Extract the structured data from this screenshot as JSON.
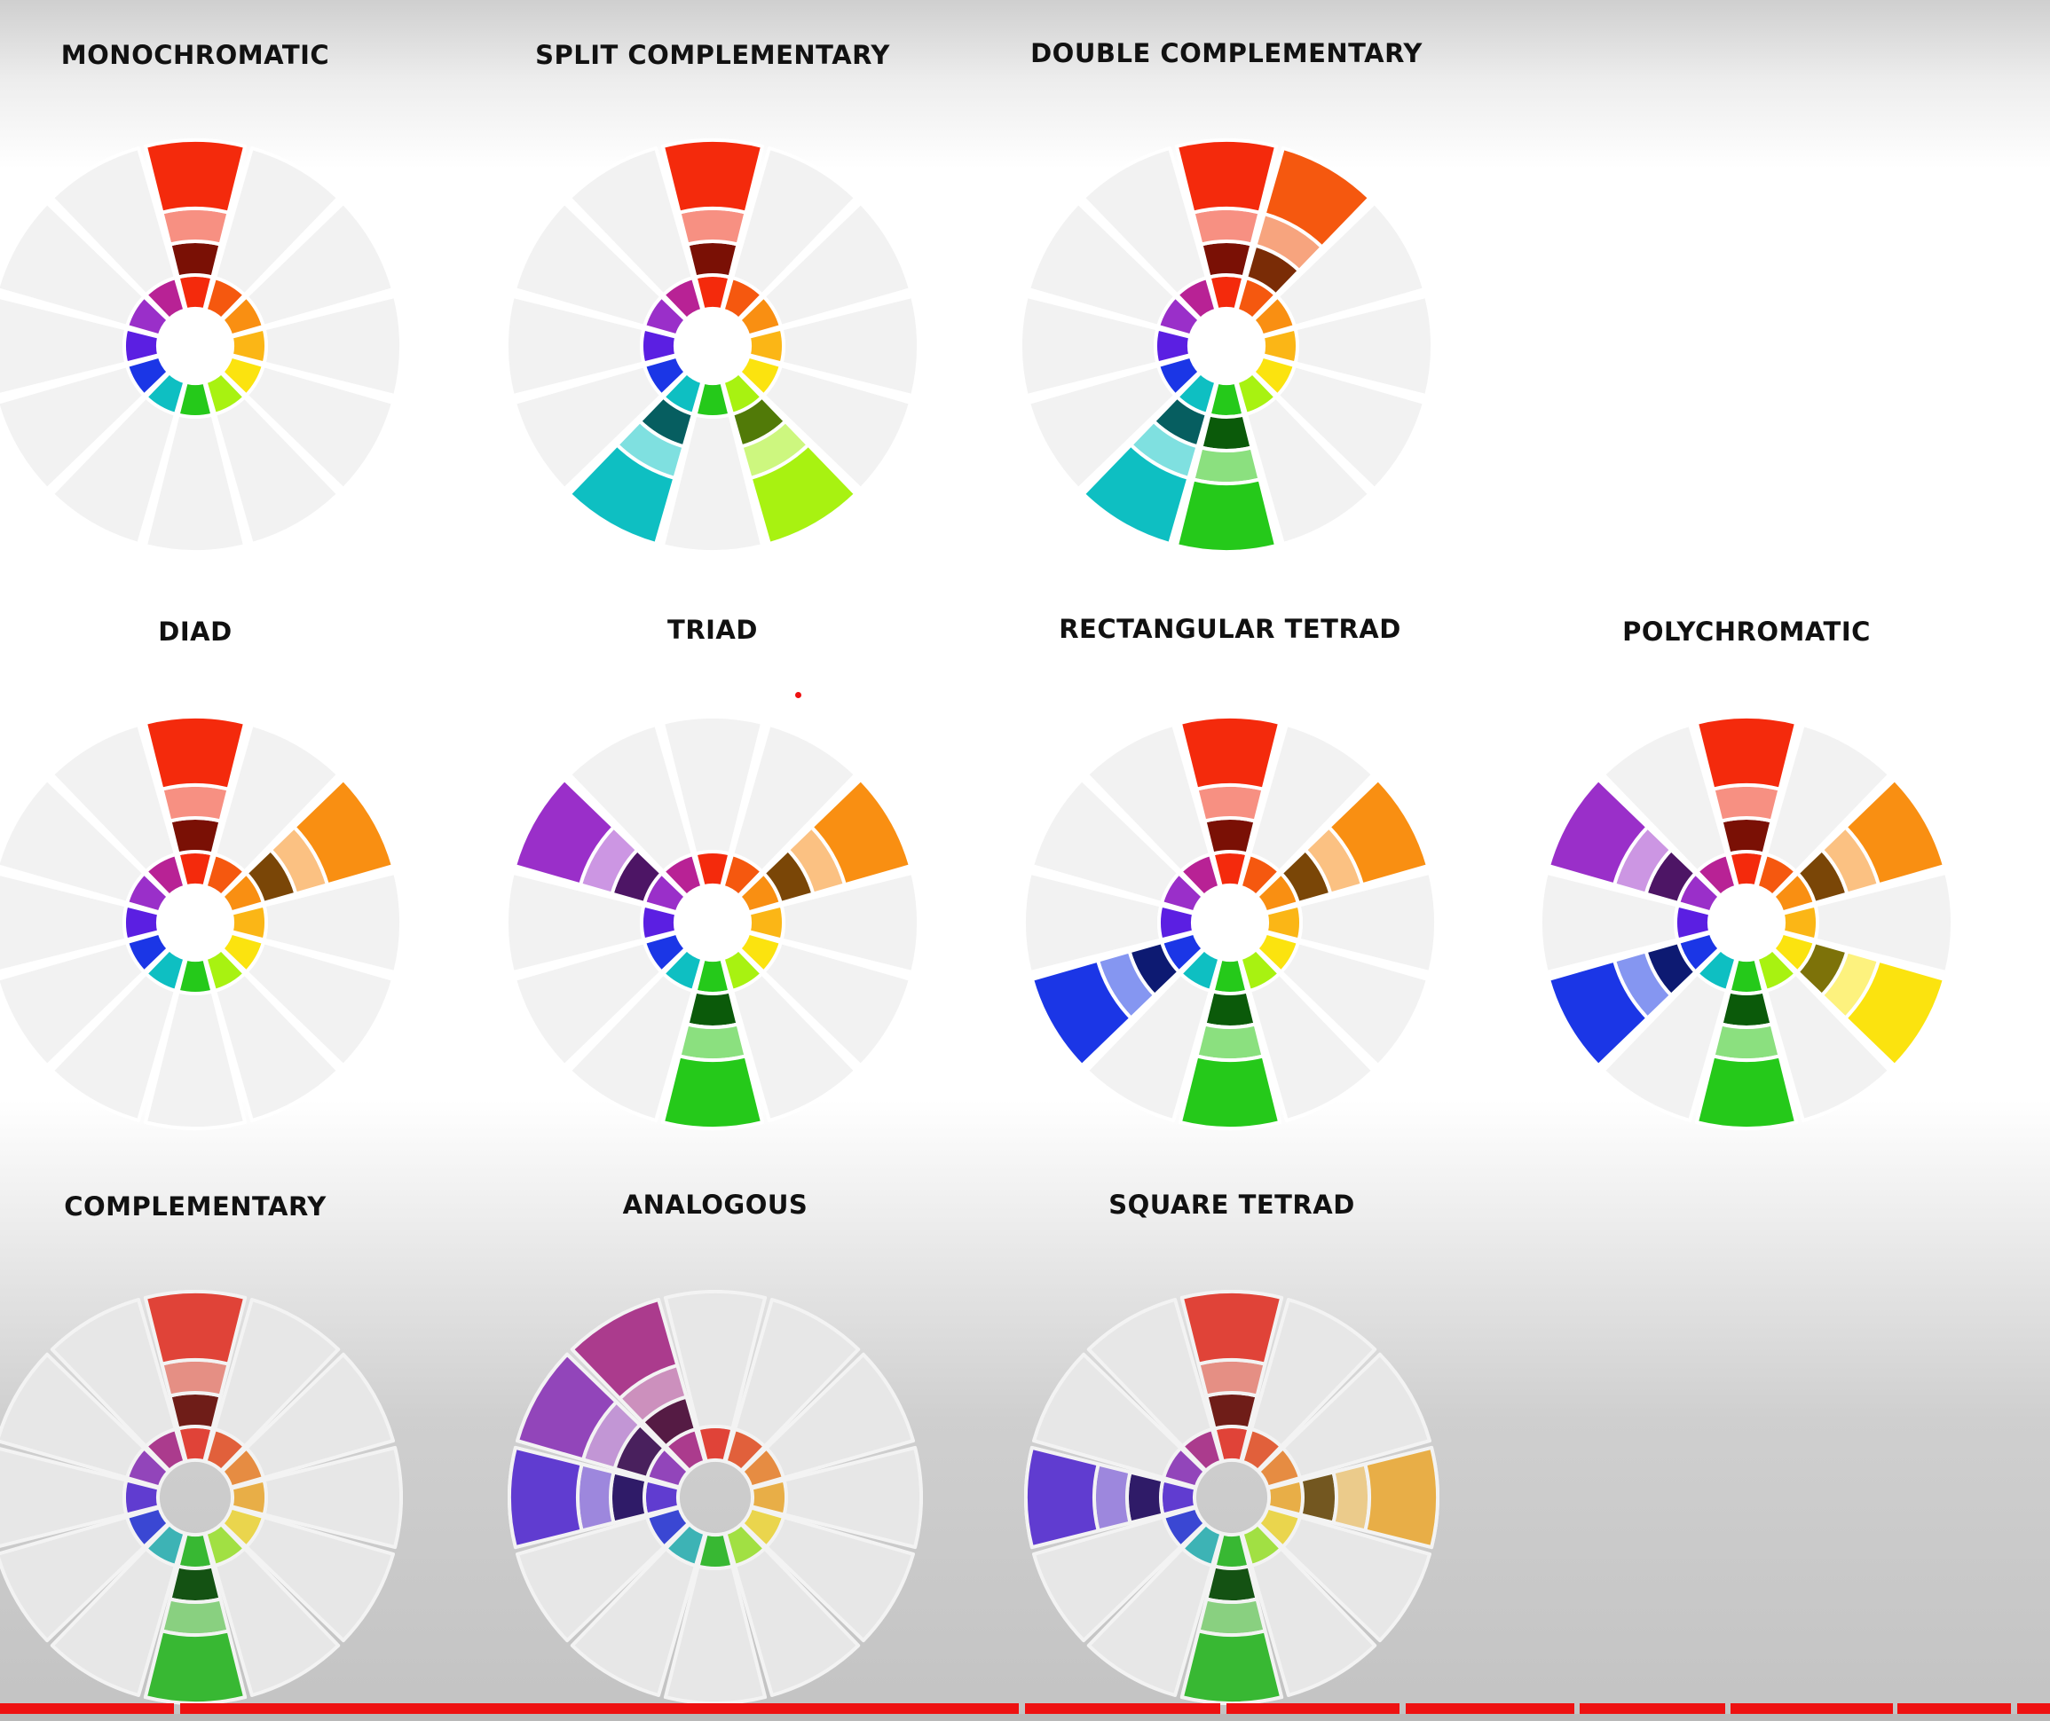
{
  "colors": {
    "hues": [
      "#f42a0c",
      "#f5580f",
      "#f98f12",
      "#fbb616",
      "#fbe30f",
      "#a8f211",
      "#25c91a",
      "#0ebfc2",
      "#1b36e6",
      "#5b1fe2",
      "#9a2fc9",
      "#b82295"
    ],
    "dark": [
      "#7a1005",
      "#7a2c06",
      "#7a4607",
      "#7d5c09",
      "#7d7209",
      "#517a08",
      "#0b5a0a",
      "#065e60",
      "#0d1a72",
      "#2d0d72",
      "#4d1565",
      "#5c1048"
    ],
    "light": [
      "#f79082",
      "#f7a47e",
      "#fbc182",
      "#fcd585",
      "#fdf27e",
      "#cdf77f",
      "#8be07f",
      "#7fe0e0",
      "#8596f1",
      "#a185ee",
      "#cc96e3",
      "#d990c7"
    ],
    "background_segment": "#f2f2f2",
    "progress": "#ee1111"
  },
  "wheels": [
    {
      "name": "MONOCHROMATIC",
      "dim": false,
      "selected": [
        0
      ]
    },
    {
      "name": "SPLIT COMPLEMENTARY",
      "dim": false,
      "selected": [
        0,
        5,
        7
      ]
    },
    {
      "name": "DOUBLE COMPLEMENTARY",
      "dim": false,
      "selected": [
        0,
        1,
        6,
        7
      ]
    },
    {
      "name": "DIAD",
      "dim": false,
      "selected": [
        0,
        2
      ]
    },
    {
      "name": "TRIAD",
      "dim": false,
      "selected": [
        2,
        6,
        10
      ]
    },
    {
      "name": "RECTANGULAR TETRAD",
      "dim": false,
      "selected": [
        0,
        2,
        6,
        8
      ]
    },
    {
      "name": "POLYCHROMATIC",
      "dim": false,
      "selected": [
        0,
        2,
        4,
        6,
        8,
        10
      ]
    },
    {
      "name": "COMPLEMENTARY",
      "dim": true,
      "selected": [
        0,
        6
      ]
    },
    {
      "name": "ANALOGOUS",
      "dim": true,
      "selected": [
        9,
        10,
        11
      ]
    },
    {
      "name": "SQUARE TETRAD",
      "dim": true,
      "selected": [
        0,
        3,
        6,
        9
      ]
    }
  ]
}
